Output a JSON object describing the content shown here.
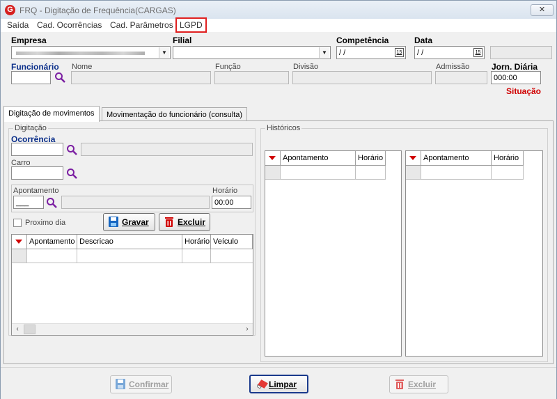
{
  "window": {
    "app_logo": "G",
    "title": "FRQ - Digitação de Frequência(CARGAS)",
    "close_label": "✕"
  },
  "menu": {
    "items": [
      "Saída",
      "Cad. Ocorrências",
      "Cad. Parâmetros",
      "LGPD"
    ]
  },
  "header": {
    "empresa_label": "Empresa",
    "filial_label": "Filial",
    "competencia_label": "Competência",
    "competencia_value": " / /",
    "data_label": "Data",
    "data_value": " / /",
    "calendar_icon_text": "15",
    "funcionario_label": "Funcionário",
    "nome_label": "Nome",
    "funcao_label": "Função",
    "divisao_label": "Divisão",
    "admissao_label": "Admissão",
    "jorn_label": "Jorn. Diária",
    "jorn_value": "000:00",
    "situacao_label": "Situação"
  },
  "tabs": [
    {
      "label": "Digitação de movimentos",
      "active": true
    },
    {
      "label": "Movimentação do funcionário (consulta)",
      "active": false
    }
  ],
  "digitacao": {
    "group_title": "Digitação",
    "ocorrencia_label": "Ocorrência",
    "carro_label": "Carro",
    "apontamento_label": "Apontamento",
    "apontamento_value": "___",
    "horario_label": "Horário",
    "horario_value": "00:00",
    "proximo_dia_label": "Proximo dia",
    "gravar_label": "Gravar",
    "excluir_label": "Excluir",
    "grid_columns": [
      "Apontamento",
      "Descricao",
      "Horário",
      "Veículo"
    ]
  },
  "historicos": {
    "group_title": "Históricos",
    "grid1_columns": [
      "Apontamento",
      "Horário"
    ],
    "grid2_columns": [
      "Apontamento",
      "Horário"
    ]
  },
  "footer": {
    "confirmar_label": "Confirmar",
    "limpar_label": "Limpar",
    "excluir_label": "Excluir"
  },
  "colors": {
    "accent_red": "#d00000",
    "magnifier_purple": "#7b1fa2",
    "save_blue": "#1565c0"
  }
}
